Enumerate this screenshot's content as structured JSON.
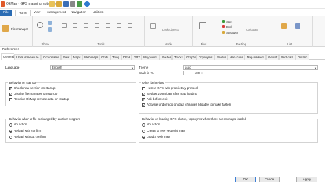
{
  "app": {
    "title": "OkMap - GPS mapping software"
  },
  "colors": {
    "accent": "#2b6cb3",
    "check": "#111111"
  },
  "menu": {
    "file": "File",
    "home": "Home",
    "view": "View",
    "management": "Management",
    "navigation": "Navigation",
    "utilities": "Utilities"
  },
  "ribbon": {
    "file_manager": "File manager",
    "groups": {
      "show": "Show",
      "tools": "Tools",
      "mode": "Mode",
      "find": "Find",
      "routing": "Routing",
      "list": "List"
    },
    "lock_objects": "Lock objects",
    "start": "Start",
    "end": "End",
    "stopover": "Stopover",
    "calculate": "Calculate"
  },
  "prefs": {
    "title": "Preferences",
    "tabs": [
      "General",
      "Units of measure",
      "Coordinates",
      "View",
      "Maps",
      "Web maps",
      "Grids",
      "Tiling",
      "DEM",
      "GPX",
      "Waypoints",
      "Routes",
      "Tracks",
      "Graphs",
      "Toponyms",
      "Photos",
      "Map icons",
      "Map markers",
      "Georef",
      "Vect data",
      "Distanc"
    ],
    "language_label": "Language",
    "language_value": "English",
    "theme_label": "Theme",
    "theme_value": "auto",
    "scale_label": "Scale in %",
    "scale_value": "100",
    "behavior_startup": {
      "title": "Behavior on startup",
      "items": [
        {
          "label": "Check new version on startup",
          "checked": true
        },
        {
          "label": "Display file manager on startup",
          "checked": true
        },
        {
          "label": "Receive OkMap remote data on startup",
          "checked": false
        }
      ]
    },
    "other_behaviors": {
      "title": "Other behaviors",
      "items": [
        {
          "label": "I use a GPS with proprietary protocol",
          "checked": false
        },
        {
          "label": "Set last zoom/pan after map loading",
          "checked": true
        },
        {
          "label": "Ask before exit",
          "checked": true
        },
        {
          "label": "Activate undo/redo on data changes (disable to make faster)",
          "checked": true
        }
      ]
    },
    "file_changed": {
      "title": "Behavior when a file is changed by another program",
      "options": [
        {
          "label": "No action",
          "selected": false
        },
        {
          "label": "Reload with confirm",
          "selected": true
        },
        {
          "label": "Reload without confirm",
          "selected": false
        }
      ]
    },
    "loading_gpx": {
      "title": "Behavior on loading GPX photos, toponyms when there are no maps loaded",
      "options": [
        {
          "label": "No action",
          "selected": false
        },
        {
          "label": "Create a new vectorial map",
          "selected": false
        },
        {
          "label": "Load a web map",
          "selected": true
        }
      ]
    },
    "buttons": {
      "ok": "OK",
      "cancel": "Cancel",
      "apply": "Apply"
    }
  }
}
